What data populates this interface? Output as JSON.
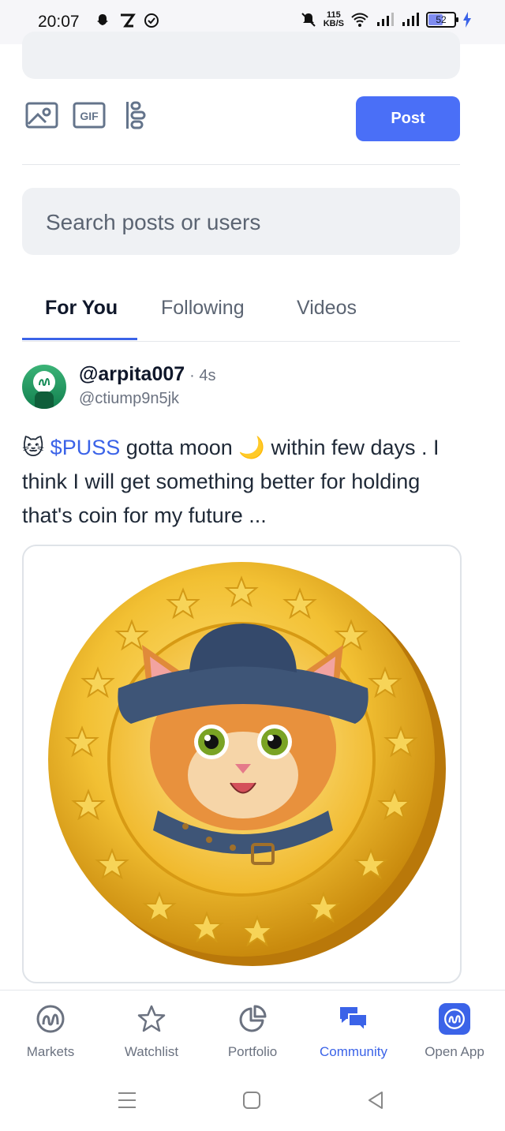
{
  "status_bar": {
    "time": "20:07",
    "net_speed_value": "115",
    "net_speed_unit": "KB/S",
    "battery": "52"
  },
  "composer": {
    "post_label": "Post",
    "tools": [
      "image-icon",
      "gif-icon",
      "poll-icon"
    ],
    "gif_text": "GIF"
  },
  "search": {
    "placeholder": "Search posts or users"
  },
  "tabs": [
    {
      "label": "For You",
      "active": true
    },
    {
      "label": "Following",
      "active": false
    },
    {
      "label": "Videos",
      "active": false
    }
  ],
  "post": {
    "author": "@arpita007",
    "time": "· 4s",
    "handle": "@ctiump9n5jk",
    "text_emoji_start": "🐱",
    "ticker": "$PUSS",
    "text_part1": " gotta moon ",
    "moon_emoji": "🌙",
    "text_part2": " within few days . I think I will get something better for holding that's coin for my future ...",
    "image": "puss-coin-image"
  },
  "bottom_nav": [
    {
      "label": "Markets",
      "icon": "markets-icon",
      "active": false
    },
    {
      "label": "Watchlist",
      "icon": "star-icon",
      "active": false
    },
    {
      "label": "Portfolio",
      "icon": "pie-chart-icon",
      "active": false
    },
    {
      "label": "Community",
      "icon": "chat-bubbles-icon",
      "active": true
    },
    {
      "label": "Open App",
      "icon": "app-logo-icon",
      "active": false
    }
  ],
  "colors": {
    "accent": "#3b63e8",
    "post_button": "#4a6ff7",
    "coin_gold": "#f2c033"
  }
}
